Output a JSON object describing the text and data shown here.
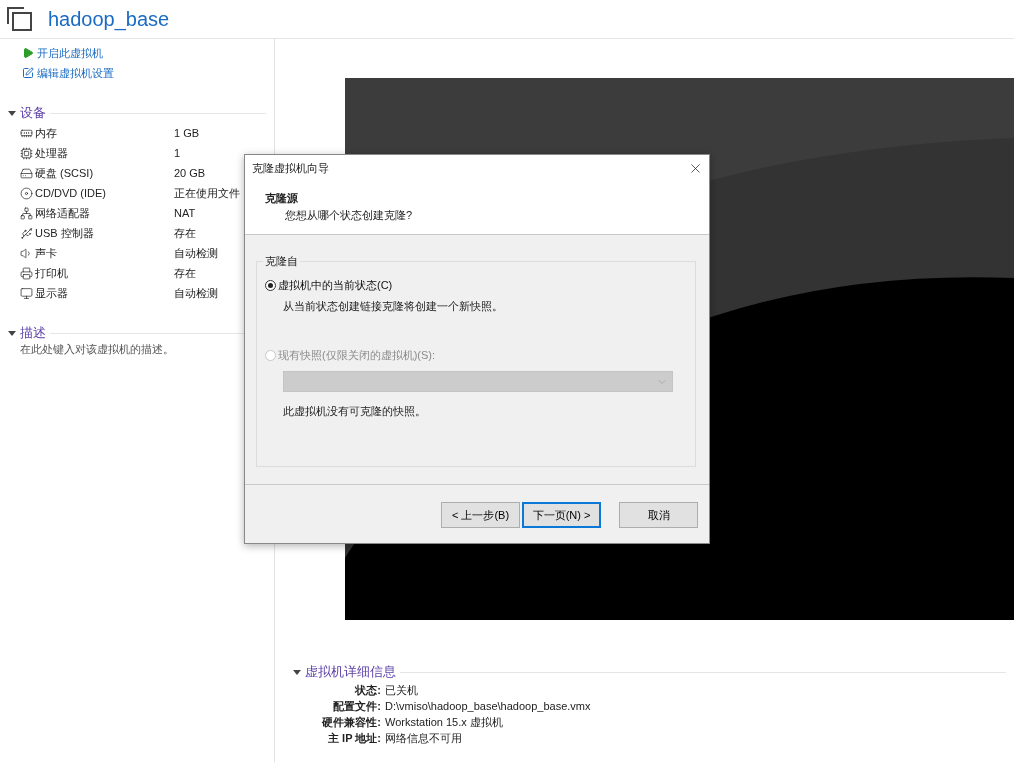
{
  "title": "hadoop_base",
  "actions": [
    {
      "label": "开启此虚拟机",
      "kind": "play"
    },
    {
      "label": "编辑虚拟机设置",
      "kind": "edit"
    }
  ],
  "devices": {
    "heading": "设备",
    "expanded": true,
    "items": [
      {
        "name": "内存",
        "value": "1 GB",
        "kind": "memory"
      },
      {
        "name": "处理器",
        "value": "1",
        "kind": "cpu"
      },
      {
        "name": "硬盘 (SCSI)",
        "value": "20 GB",
        "kind": "disk"
      },
      {
        "name": "CD/DVD (IDE)",
        "value": "正在使用文件",
        "kind": "cd"
      },
      {
        "name": "网络适配器",
        "value": "NAT",
        "kind": "network"
      },
      {
        "name": "USB 控制器",
        "value": "存在",
        "kind": "usb"
      },
      {
        "name": "声卡",
        "value": "自动检测",
        "kind": "sound"
      },
      {
        "name": "打印机",
        "value": "存在",
        "kind": "printer"
      },
      {
        "name": "显示器",
        "value": "自动检测",
        "kind": "display"
      }
    ]
  },
  "description": {
    "heading": "描述",
    "expanded": true,
    "text": "在此处键入对该虚拟机的描述。"
  },
  "details": {
    "heading": "虚拟机详细信息",
    "expanded": true,
    "rows": [
      {
        "label": "状态:",
        "value": "已关机"
      },
      {
        "label": "配置文件:",
        "value": "D:\\vmiso\\hadoop_base\\hadoop_base.vmx"
      },
      {
        "label": "硬件兼容性:",
        "value": "Workstation 15.x 虚拟机"
      },
      {
        "label": "主 IP 地址:",
        "value": "网络信息不可用"
      }
    ]
  },
  "dialog": {
    "title": "克隆虚拟机向导",
    "heading": "克隆源",
    "subheading": "您想从哪个状态创建克隆?",
    "group_label": "克隆自",
    "options": [
      {
        "label": "虚拟机中的当前状态(C)",
        "selected": true,
        "disabled": false,
        "note": "从当前状态创建链接克隆将创建一个新快照。"
      },
      {
        "label": "现有快照(仅限关闭的虚拟机)(S):",
        "selected": false,
        "disabled": true,
        "dropdown": {
          "disabled": true
        },
        "note": "此虚拟机没有可克隆的快照。"
      }
    ],
    "buttons": [
      {
        "label": "< 上一步(B)",
        "default": false
      },
      {
        "label": "下一页(N) >",
        "default": true
      },
      {
        "label": "取消",
        "default": false
      }
    ]
  }
}
